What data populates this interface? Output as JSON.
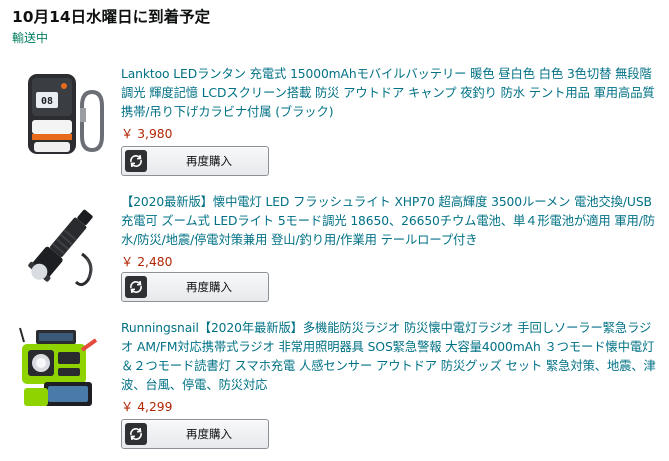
{
  "order": {
    "delivery_title": "10月14日水曜日に到着予定",
    "status": "輸送中"
  },
  "items": [
    {
      "title": "Lanktoo LEDランタン 充電式 15000mAhモバイルバッテリー 暖色 昼白色 白色 3色切替 無段階調光 輝度記憶 LCDスクリーン搭載 防災 アウトドア キャンプ 夜釣り 防水 テント用品 軍用高品質 携帯/吊り下げカラビナ付属 (ブラック)",
      "price": "￥ 3,980",
      "buy_again_label": "再度購入",
      "thumb_screen_text": "08",
      "thumb_screen_color": "#1a1d22"
    },
    {
      "title": "【2020最新版】懐中電灯 LED フラッシュライト XHP70 超高輝度 3500ルーメン 電池交換/USB充電可 ズーム式 LEDライト 5モード調光 18650、26650チウム電池、単４形電池が適用 軍用/防水/防災/地震/停電対策兼用 登山/釣り用/作業用 テールロープ付き",
      "price": "￥ 2,480",
      "buy_again_label": "再度購入"
    },
    {
      "title": "Runningsnail【2020年最新版】多機能防災ラジオ 防災懐中電灯ラジオ 手回しソーラー緊急ラジオ AM/FM対応携帯式ラジオ 非常用照明器具 SOS緊急警報 大容量4000mAh ３つモード懐中電灯＆２つモード読書灯 スマホ充電 人感センサー アウトドア 防災グッズ セット 緊急対策、地震、津波、台風、停電、防災対応",
      "price": "￥ 4,299",
      "buy_again_label": "再度購入",
      "thumb_accent_color": "#8fd400"
    }
  ],
  "colors": {
    "link": "#007185",
    "price": "#b12704",
    "status": "#067d62"
  },
  "icons": [
    "buy-again-icon"
  ]
}
